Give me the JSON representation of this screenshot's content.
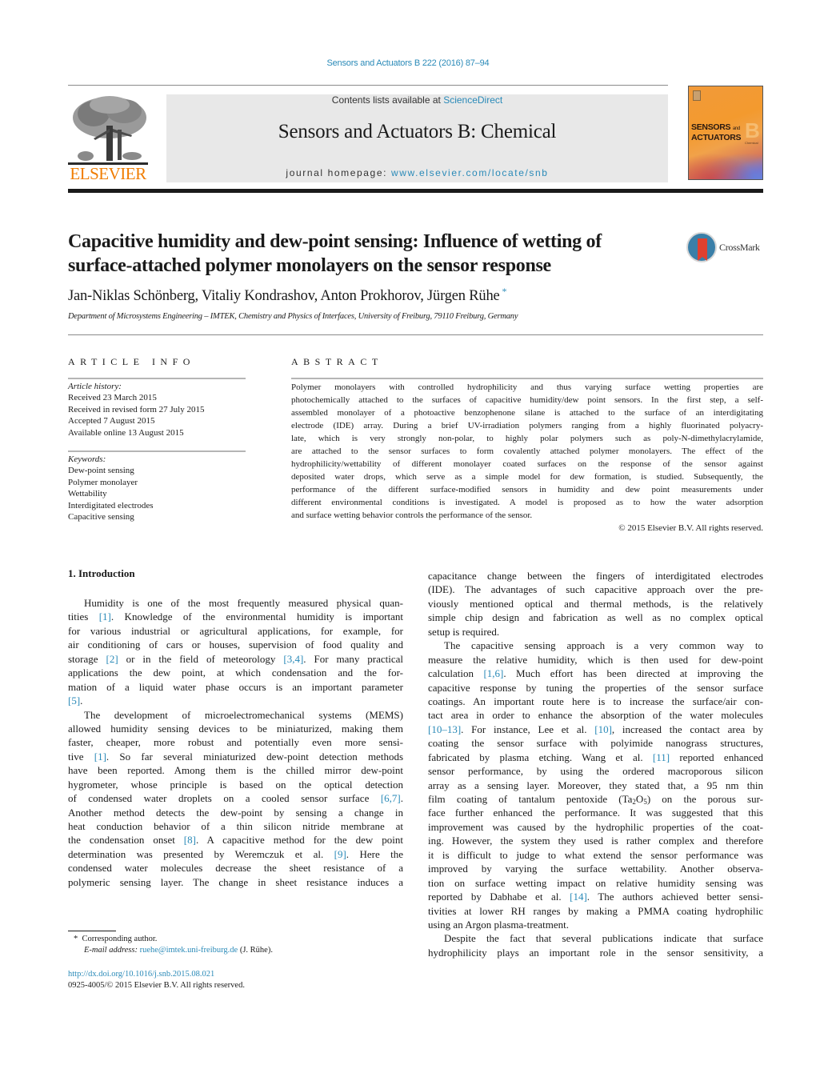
{
  "journal_reference": "Sensors and Actuators B 222 (2016) 87–94",
  "masthead": {
    "publisher_logo_text": "ELSEVIER",
    "contents_prefix": "Contents lists available at ",
    "contents_link": "ScienceDirect",
    "journal_title": "Sensors and Actuators B: Chemical",
    "homepage_prefix": "journal homepage: ",
    "homepage_link": "www.elsevier.com/locate/snb",
    "cover": {
      "line1": "SENSORS",
      "and": "and",
      "line2": "ACTUATORS",
      "letter": "B",
      "subtitle": "Chemical"
    }
  },
  "article": {
    "title_line1": "Capacitive humidity and dew-point sensing: Influence of wetting of",
    "title_line2": "surface-attached polymer monolayers on the sensor response",
    "crossmark_label": "CrossMark",
    "authors": "Jan-Niklas Schönberg, Vitaliy Kondrashov, Anton Prokhorov, Jürgen Rühe",
    "corresponding_marker": "*",
    "affiliation": "Department of Microsystems Engineering – IMTEK, Chemistry and Physics of Interfaces, University of Freiburg, 79110 Freiburg, Germany"
  },
  "article_info": {
    "heading": "ARTICLE INFO",
    "history_label": "Article history:",
    "history": [
      "Received 23 March 2015",
      "Received in revised form 27 July 2015",
      "Accepted 7 August 2015",
      "Available online 13 August 2015"
    ],
    "keywords_label": "Keywords:",
    "keywords": [
      "Dew-point sensing",
      "Polymer monolayer",
      "Wettability",
      "Interdigitated electrodes",
      "Capacitive sensing"
    ]
  },
  "abstract": {
    "heading": "ABSTRACT",
    "lines": [
      "Polymer monolayers with controlled hydrophilicity and thus varying surface wetting properties are",
      "photochemically attached to the surfaces of capacitive humidity/dew point sensors. In the first step, a self-",
      "assembled monolayer of a photoactive benzophenone silane is attached to the surface of an interdigitating",
      "electrode (IDE) array. During a brief UV-irradiation polymers ranging from a highly fluorinated polyacry-",
      "late, which is very strongly non-polar, to highly polar polymers such as poly-N-dimethylacrylamide,",
      "are attached to the sensor surfaces to form covalently attached polymer monolayers. The effect of the",
      "hydrophilicity/wettability of different monolayer coated surfaces on the response of the sensor against",
      "deposited water drops, which serve as a simple model for dew formation, is studied. Subsequently, the",
      "performance of the different surface-modified sensors in humidity and dew point measurements under",
      "different environmental conditions is investigated. A model is proposed as to how the water adsorption",
      "and surface wetting behavior controls the performance of the sensor."
    ],
    "copyright": "© 2015 Elsevier B.V. All rights reserved."
  },
  "body": {
    "section_heading": "1.  Introduction",
    "left_column": [
      {
        "t": "Humidity is one of the most frequently measured physical quan-",
        "indent": true
      },
      {
        "segs": [
          "tities ",
          {
            "ref": "[1]"
          },
          ". Knowledge of the environmental humidity is important"
        ]
      },
      {
        "t": "for various industrial or agricultural applications, for example, for"
      },
      {
        "t": "air conditioning of cars or houses, supervision of food quality and"
      },
      {
        "segs": [
          "storage ",
          {
            "ref": "[2]"
          },
          " or in the field of meteorology ",
          {
            "ref": "[3,4]"
          },
          ". For many practical"
        ]
      },
      {
        "t": "applications the dew point, at which condensation and the for-"
      },
      {
        "t": "mation of a liquid water phase occurs is an important parameter"
      },
      {
        "segs": [
          {
            "ref": "[5]"
          },
          "."
        ],
        "last": true
      },
      {
        "t": "The development of microelectromechanical systems (MEMS)",
        "indent": true
      },
      {
        "t": "allowed humidity sensing devices to be miniaturized, making them"
      },
      {
        "t": "faster, cheaper, more robust and potentially even more sensi-"
      },
      {
        "segs": [
          "tive ",
          {
            "ref": "[1]"
          },
          ". So far several miniaturized dew-point detection methods"
        ]
      },
      {
        "t": "have been reported. Among them is the chilled mirror dew-point"
      },
      {
        "t": "hygrometer, whose principle is based on the optical detection"
      },
      {
        "segs": [
          "of condensed water droplets on a cooled sensor surface ",
          {
            "ref": "[6,7]"
          },
          "."
        ]
      },
      {
        "t": "Another method detects the dew-point by sensing a change in"
      },
      {
        "t": "heat conduction behavior of a thin silicon nitride membrane at"
      },
      {
        "segs": [
          "the condensation onset ",
          {
            "ref": "[8]"
          },
          ". A capacitive method for the dew point"
        ]
      },
      {
        "segs": [
          "determination was presented by Weremczuk et al. ",
          {
            "ref": "[9]"
          },
          ". Here the"
        ]
      },
      {
        "t": "condensed water molecules decrease the sheet resistance of a"
      },
      {
        "t": "polymeric sensing layer. The change in sheet resistance induces a"
      }
    ],
    "right_column": [
      {
        "t": "capacitance change between the fingers of interdigitated electrodes"
      },
      {
        "t": "(IDE). The advantages of such capacitive approach over the pre-"
      },
      {
        "t": "viously mentioned optical and thermal methods, is the relatively"
      },
      {
        "t": "simple chip design and fabrication as well as no complex optical"
      },
      {
        "t": "setup is required.",
        "last": true
      },
      {
        "t": "The capacitive sensing approach is a very common way to",
        "indent": true
      },
      {
        "t": "measure the relative humidity, which is then used for dew-point"
      },
      {
        "segs": [
          "calculation ",
          {
            "ref": "[1,6]"
          },
          ". Much effort has been directed at improving the"
        ]
      },
      {
        "t": "capacitive response by tuning the properties of the sensor surface"
      },
      {
        "t": "coatings. An important route here is to increase the surface/air con-"
      },
      {
        "t": "tact area in order to enhance the absorption of the water molecules"
      },
      {
        "segs": [
          {
            "ref": "[10–13]"
          },
          ". For instance, Lee et al. ",
          {
            "ref": "[10]"
          },
          ", increased the contact area by"
        ]
      },
      {
        "t": "coating the sensor surface with polyimide nanograss structures,"
      },
      {
        "segs": [
          "fabricated by plasma etching. Wang et al. ",
          {
            "ref": "[11]"
          },
          " reported enhanced"
        ]
      },
      {
        "t": "sensor performance, by using the ordered macroporous silicon"
      },
      {
        "t": "array as a sensing layer. Moreover, they stated that, a 95 nm thin"
      },
      {
        "segs": [
          "film coating of tantalum pentoxide (Ta",
          {
            "sub": "2"
          },
          "O",
          {
            "sub": "5"
          },
          ") on the porous sur-"
        ]
      },
      {
        "t": "face further enhanced the performance. It was suggested that this"
      },
      {
        "t": "improvement was caused by the hydrophilic properties of the coat-"
      },
      {
        "t": "ing. However, the system they used is rather complex and therefore"
      },
      {
        "t": "it is difficult to judge to what extend the sensor performance was"
      },
      {
        "t": "improved by varying the surface wettability. Another observa-"
      },
      {
        "t": "tion on surface wetting impact on relative humidity sensing was"
      },
      {
        "segs": [
          "reported by Dabhabe et al. ",
          {
            "ref": "[14]"
          },
          ". The authors achieved better sensi-"
        ]
      },
      {
        "t": "tivities at lower RH ranges by making a PMMA coating hydrophilic"
      },
      {
        "t": "using an Argon plasma-treatment.",
        "last": true
      },
      {
        "t": "Despite the fact that several publications indicate that surface",
        "indent": true
      },
      {
        "t": "hydrophilicity plays an important role in the sensor sensitivity, a"
      }
    ]
  },
  "footnotes": {
    "marker": "*",
    "corresponding": "Corresponding author.",
    "email_label": "E-mail address: ",
    "email": "ruehe@imtek.uni-freiburg.de",
    "email_suffix": " (J. Rühe).",
    "doi": "http://dx.doi.org/10.1016/j.snb.2015.08.021",
    "issn": "0925-4005/© 2015 Elsevier B.V. All rights reserved."
  },
  "colors": {
    "link": "#2a8ab8",
    "elsevier_orange": "#f07c00",
    "masthead_gray": "#e8e8e8"
  }
}
